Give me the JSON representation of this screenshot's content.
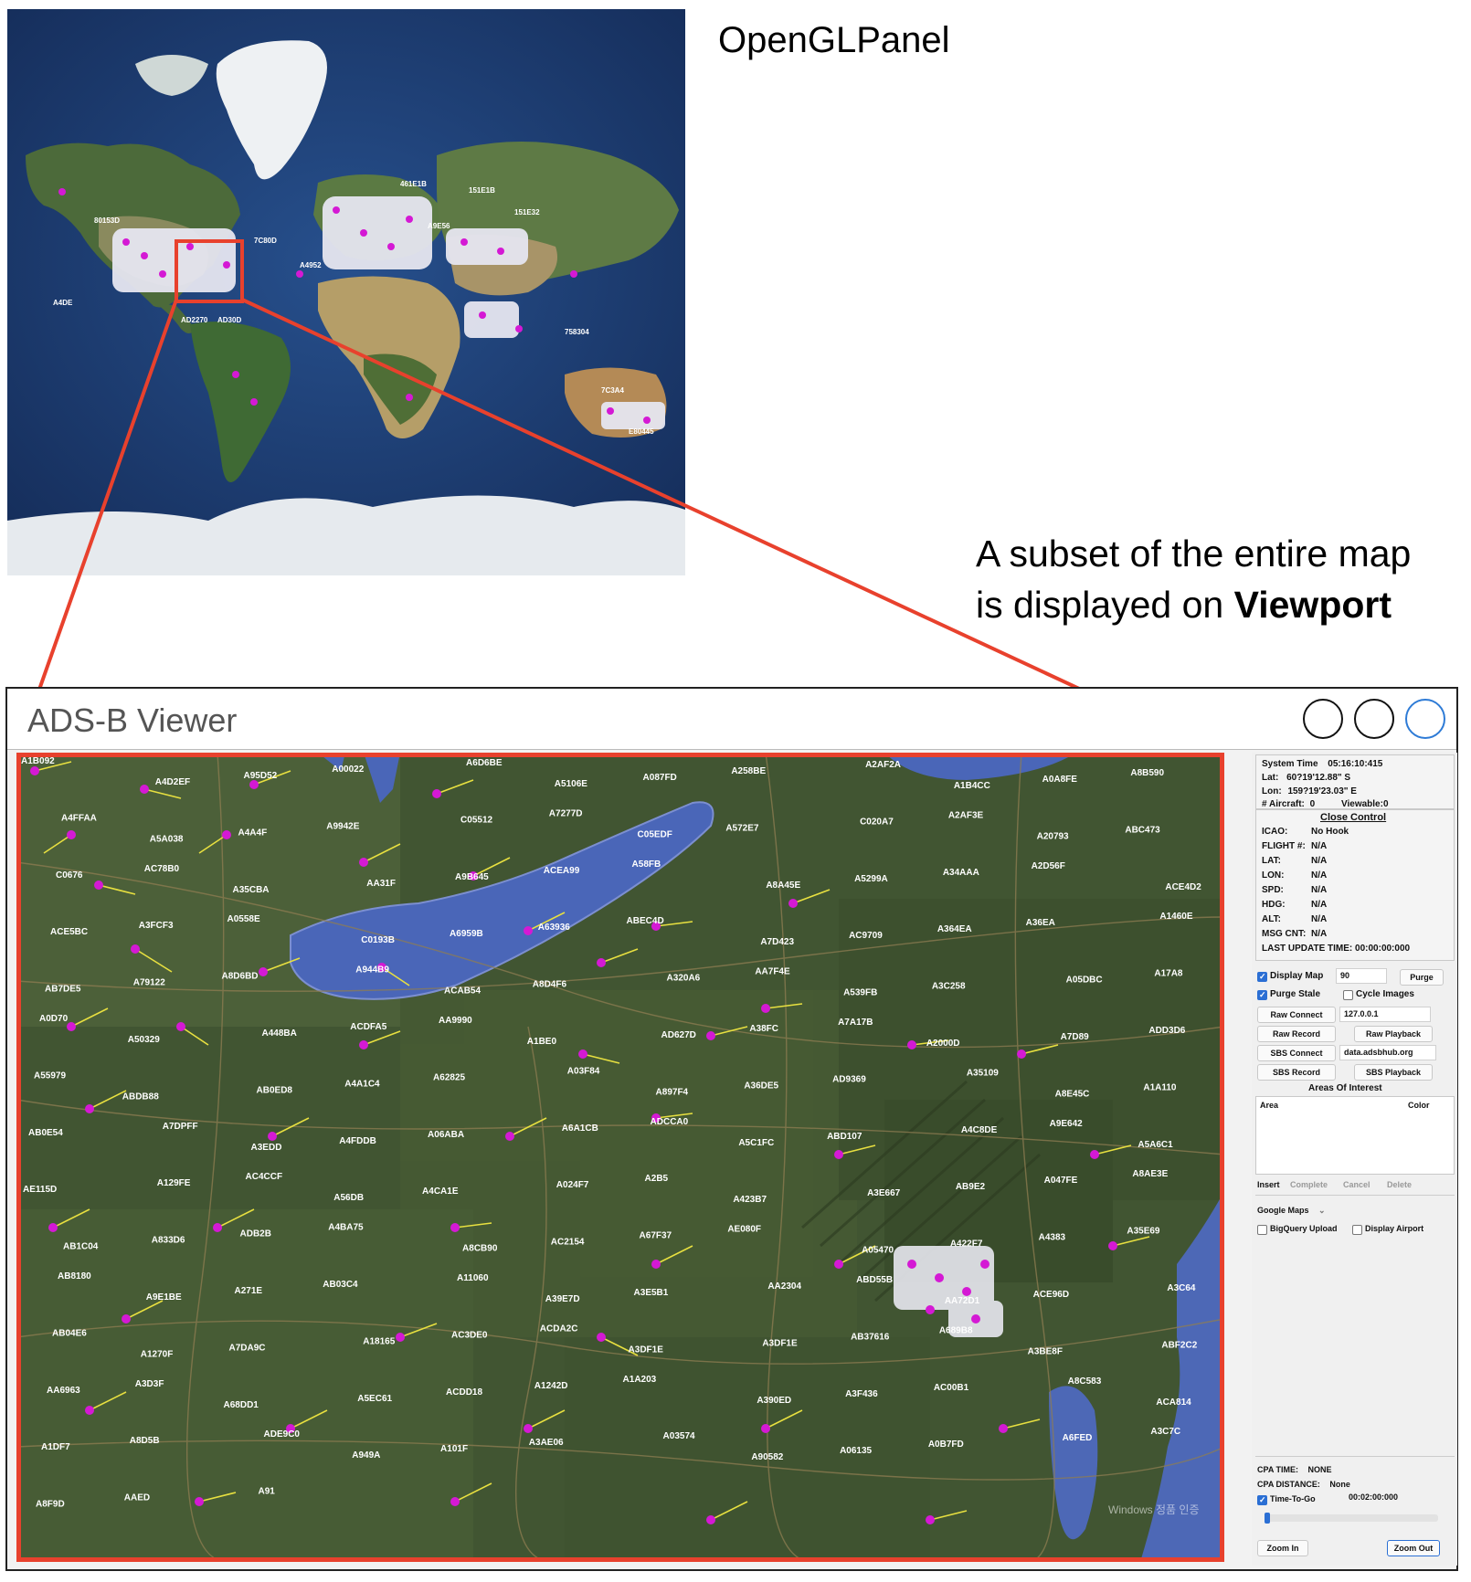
{
  "annotations": {
    "top_title": "OpenGLPanel",
    "subset_line1": "A subset of the entire map",
    "subset_line2_prefix": "is displayed on ",
    "subset_line2_bold": "Viewport"
  },
  "world_map": {
    "labels": [
      "461E1B",
      "151E1B",
      "151E32",
      "A9E56",
      "80153D",
      "7C80D",
      "A4952",
      "A4DE",
      "AD2270",
      "AD30D",
      "758304",
      "E80445",
      "7C3A4"
    ]
  },
  "window": {
    "title": "ADS-B Viewer"
  },
  "viewport": {
    "labels": [
      "A1B092",
      "A4D2EF",
      "A95D52",
      "A00022",
      "A6D6BE",
      "A5106E",
      "A087FD",
      "A258BE",
      "A2AF2A",
      "A1B4CC",
      "A0A8FE",
      "A8B590",
      "A4FFAA",
      "A5A038",
      "A4A4F",
      "A9942E",
      "C05512",
      "A7277D",
      "C05EDF",
      "A572E7",
      "C020A7",
      "A2AF3E",
      "A20793",
      "ABC473",
      "C0676",
      "AC78B0",
      "A35CBA",
      "AA31F",
      "A9B645",
      "ACEA99",
      "A58FB",
      "A8A45E",
      "A5299A",
      "A34AAA",
      "A2D56F",
      "ACE4D2",
      "ACE5BC",
      "A3FCF3",
      "A0558E",
      "C0193B",
      "A6959B",
      "A63936",
      "ABEC4D",
      "A7D423",
      "AC9709",
      "A364EA",
      "A36EA",
      "A1460E",
      "AB7DE5",
      "A79122",
      "A8D6BD",
      "A944B9",
      "ACAB54",
      "A8D4F6",
      "A320A6",
      "AA7F4E",
      "A539FB",
      "A3C258",
      "A05DBC",
      "A17A8",
      "A0D70",
      "A50329",
      "A448BA",
      "ACDFA5",
      "AA9990",
      "A1BE0",
      "AD627D",
      "A38FC",
      "A7A17B",
      "A2000D",
      "A7D89",
      "ADD3D6",
      "A55979",
      "ABDB88",
      "AB0ED8",
      "A4A1C4",
      "A62825",
      "A03F84",
      "A897F4",
      "A36DE5",
      "AD9369",
      "A35109",
      "A8E45C",
      "A1A110",
      "AB0E54",
      "A7DPFF",
      "A3EDD",
      "A4FDDB",
      "A06ABA",
      "A6A1CB",
      "ADCCA0",
      "A5C1FC",
      "ABD107",
      "A4C8DE",
      "A9E642",
      "A5A6C1",
      "AE115D",
      "A129FE",
      "AC4CCF",
      "A56DB",
      "A4CA1E",
      "A024F7",
      "A2B5",
      "A423B7",
      "A3E667",
      "AB9E2",
      "A047FE",
      "A8AE3E",
      "AB1C04",
      "A833D6",
      "ADB2B",
      "A4BA75",
      "A8CB90",
      "AC2154",
      "A67F37",
      "AE080F",
      "A05470",
      "A422F7",
      "A4383",
      "A35E69",
      "AB8180",
      "A9E1BE",
      "A271E",
      "AB03C4",
      "A11060",
      "A39E7D",
      "A3E5B1",
      "AA2304",
      "ABD55B",
      "AA72D1",
      "ACE96D",
      "A3C64",
      "AB04E6",
      "A1270F",
      "A7DA9C",
      "A18165",
      "AC3DE0",
      "ACDA2C",
      "A3DF1E",
      "A3DF1E",
      "AB37616",
      "A689B8",
      "A3BE8F",
      "ABF2C2",
      "AA6963",
      "A3D3F",
      "A68DD1",
      "A5EC61",
      "ACDD18",
      "A1242D",
      "A1A203",
      "A390ED",
      "A3F436",
      "AC00B1",
      "A8C583",
      "ACA814",
      "A1DF7",
      "A8D5B",
      "ADE9C0",
      "A949A",
      "A101F",
      "A3AE06",
      "A03574",
      "A90582",
      "A06135",
      "A0B7FD",
      "A6FED",
      "A3C7C",
      "A8F9D",
      "AAED",
      "A91"
    ]
  },
  "panel": {
    "system_time_label": "System Time",
    "system_time_value": "05:16:10:415",
    "lat_label": "Lat:",
    "lat_value": "60?19'12.88\" S",
    "lon_label": "Lon:",
    "lon_value": "159?19'23.03\" E",
    "aircraft_label": "# Aircraft:",
    "aircraft_value": "0",
    "viewable_label": "Viewable:",
    "viewable_value": "0",
    "close_control": "Close Control",
    "icao_label": "ICAO:",
    "icao_value": "No Hook",
    "flight_label": "FLIGHT #:",
    "flight_value": "N/A",
    "lat2_label": "LAT:",
    "lat2_value": "N/A",
    "lon2_label": "LON:",
    "lon2_value": "N/A",
    "spd_label": "SPD:",
    "spd_value": "N/A",
    "hdg_label": "HDG:",
    "hdg_value": "N/A",
    "alt_label": "ALT:",
    "alt_value": "N/A",
    "msg_label": "MSG CNT:",
    "msg_value": "N/A",
    "last_update": "LAST UPDATE TIME: 00:00:00:000",
    "display_map": "Display Map",
    "display_map_value": "90",
    "purge": "Purge",
    "purge_stale": "Purge Stale",
    "cycle_images": "Cycle Images",
    "raw_connect": "Raw Connect",
    "raw_ip": "127.0.0.1",
    "raw_record": "Raw Record",
    "raw_playback": "Raw Playback",
    "sbs_connect": "SBS Connect",
    "sbs_host": "data.adsbhub.org",
    "sbs_record": "SBS Record",
    "sbs_playback": "SBS Playback",
    "areas_title": "Areas Of Interest",
    "area_col": "Area",
    "color_col": "Color",
    "insert": "Insert",
    "complete": "Complete",
    "cancel": "Cancel",
    "delete": "Delete",
    "map_source": "Google Maps",
    "bigquery_upload": "BigQuery Upload",
    "display_airport": "Display Airport",
    "cpa_time_label": "CPA TIME:",
    "cpa_time_value": "NONE",
    "cpa_distance_label": "CPA DISTANCE:",
    "cpa_distance_value": "None",
    "time_to_go": "Time-To-Go",
    "time_to_go_value": "00:02:00:000",
    "zoom_in": "Zoom In",
    "zoom_out": "Zoom Out"
  },
  "colors": {
    "accent_red": "#e8412d",
    "aircraft_magenta": "#e020e0",
    "heading_yellow": "#e8e040",
    "checkbox_blue": "#2b6fd4"
  }
}
